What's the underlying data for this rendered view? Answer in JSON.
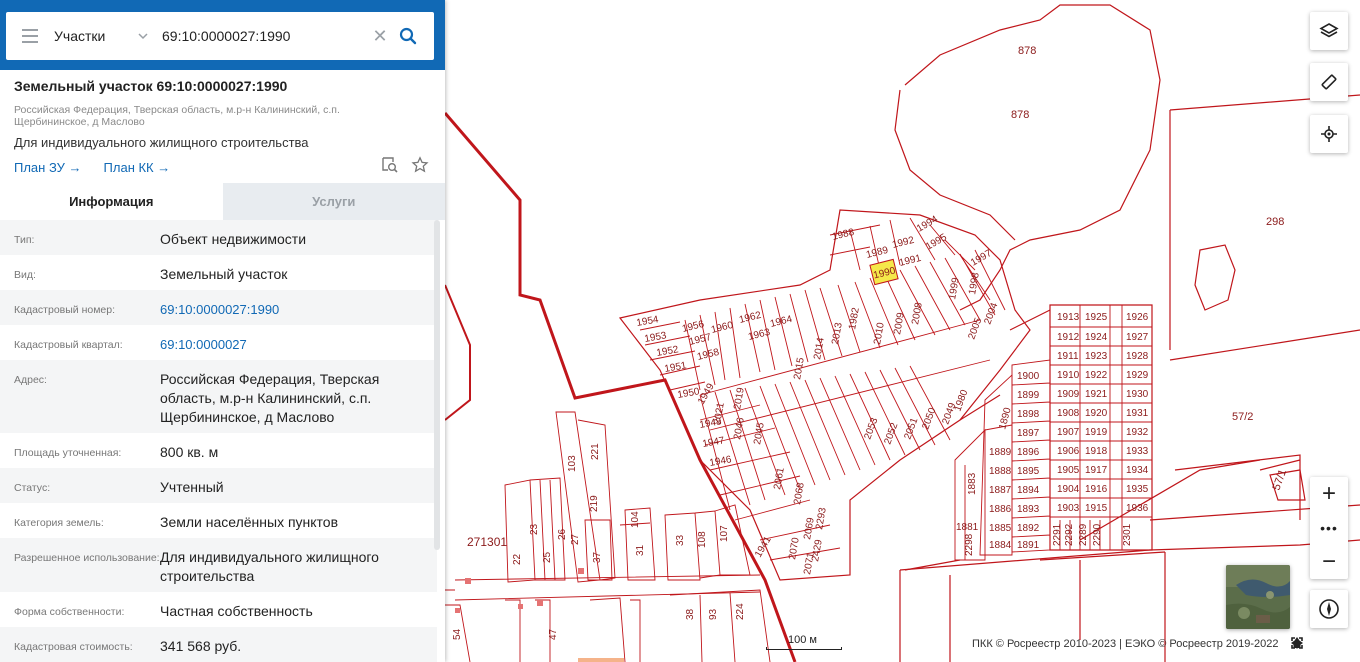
{
  "search": {
    "type_value": "Участки",
    "query": "69:10:0000027:1990"
  },
  "card": {
    "title": "Земельный участок 69:10:0000027:1990",
    "address": "Российская Федерация, Тверская область, м.р-н Калининский, с.п. Щербининское, д Маслово",
    "use": "Для индивидуального жилищного строительства",
    "link_plan_zu": "План ЗУ →",
    "link_plan_kk": "План КК →"
  },
  "tabs": {
    "info": "Информация",
    "services": "Услуги"
  },
  "info_rows": [
    {
      "key": "Тип:",
      "value": "Объект недвижимости"
    },
    {
      "key": "Вид:",
      "value": "Земельный участок"
    },
    {
      "key": "Кадастровый номер:",
      "value": "69:10:0000027:1990"
    },
    {
      "key": "Кадастровый квартал:",
      "value": "69:10:0000027"
    },
    {
      "key": "Адрес:",
      "value": "Российская Федерация, Тверская область, м.р-н Калининский, с.п. Щербининское, д Маслово"
    },
    {
      "key": "Площадь уточненная:",
      "value": "800 кв. м"
    },
    {
      "key": "Статус:",
      "value": "Учтенный"
    },
    {
      "key": "Категория земель:",
      "value": "Земли населённых пунктов"
    },
    {
      "key": "Разрешенное использование:",
      "value": "Для индивидуального жилищного строительства"
    },
    {
      "key": "Форма собственности:",
      "value": "Частная собственность"
    },
    {
      "key": "Кадастровая стоимость:",
      "value": "341 568 руб."
    }
  ],
  "map": {
    "scale_label": "100 м",
    "copyright": "ПКК © Росреестр 2010-2023 | ЕЭКО © Росреестр 2019-2022",
    "selected_parcel": "1990",
    "big_labels": [
      "878",
      "878",
      "298",
      "57/2",
      "57/1",
      "271301"
    ],
    "colors": {
      "parcel_line": "#c0161b",
      "label": "#8b1a1a",
      "highlight": "#f5e84a",
      "header": "#1169b5"
    }
  }
}
